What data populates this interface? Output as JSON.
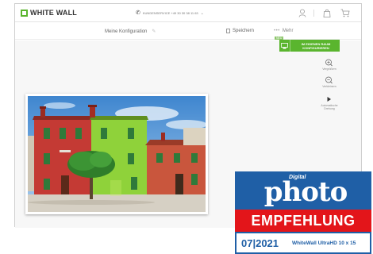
{
  "header": {
    "logo_text": "WHITE WALL",
    "hotline": "KUNDENSERVICE +49 30 30 38 11 63",
    "icons": [
      "user-icon",
      "bag-icon",
      "cart-icon"
    ]
  },
  "toolbar": {
    "config_title": "Meine Konfiguration",
    "save_label": "Speichern",
    "more_label": "Mehr"
  },
  "room_button": {
    "badge": "NEU",
    "label": "IM EIGENEN RAUM KONFIGURIEREN"
  },
  "side_tools": [
    {
      "icon": "zoom-in-icon",
      "label": "Vergrößern"
    },
    {
      "icon": "zoom-out-icon",
      "label": "Verkleinern"
    },
    {
      "icon": "play-icon",
      "label": "Automatische Drehung"
    }
  ],
  "award": {
    "digital": "Digital",
    "photo": "photo",
    "recommendation": "EMPFEHLUNG",
    "issue": "07|2021",
    "product": "WhiteWall UltraHD 10 x 15"
  },
  "colors": {
    "brand_green": "#5ab52e",
    "award_blue": "#1f5fa6",
    "award_red": "#e3151a"
  }
}
